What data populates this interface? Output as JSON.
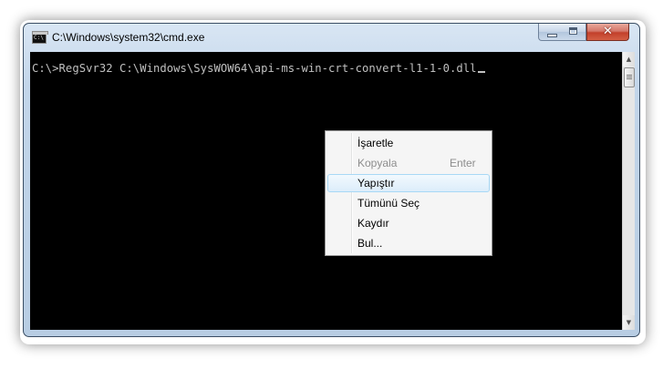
{
  "window": {
    "title": "C:\\Windows\\system32\\cmd.exe",
    "close_glyph": "✕",
    "icon": "cmd-console-icon"
  },
  "console": {
    "text": "C:\\>RegSvr32 C:\\Windows\\SysWOW64\\api-ms-win-crt-convert-l1-1-0.dll",
    "background": "#000000",
    "foreground": "#c0c0c0"
  },
  "scrollbar": {
    "up_arrow": "▲",
    "down_arrow": "▼"
  },
  "context_menu": {
    "items": [
      {
        "label": "İşaretle",
        "accelerator": "",
        "disabled": false,
        "highlighted": false
      },
      {
        "label": "Kopyala",
        "accelerator": "Enter",
        "disabled": true,
        "highlighted": false
      },
      {
        "label": "Yapıştır",
        "accelerator": "",
        "disabled": false,
        "highlighted": true
      },
      {
        "label": "Tümünü Seç",
        "accelerator": "",
        "disabled": false,
        "highlighted": false
      },
      {
        "label": "Kaydır",
        "accelerator": "",
        "disabled": false,
        "highlighted": false
      },
      {
        "label": "Bul...",
        "accelerator": "",
        "disabled": false,
        "highlighted": false
      }
    ]
  }
}
